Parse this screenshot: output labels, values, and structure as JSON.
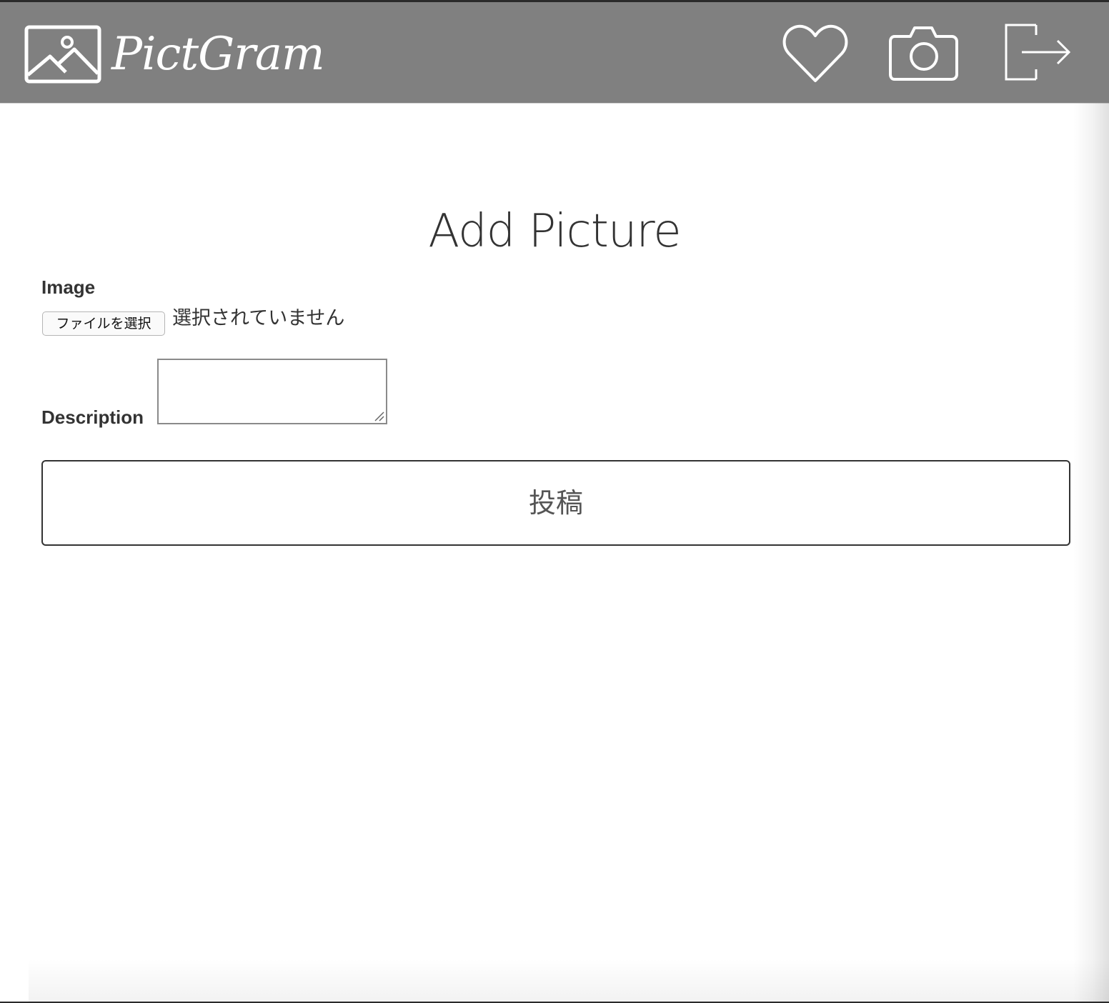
{
  "header": {
    "brand": "PictGram",
    "logo_icon": "picture-landscape-icon",
    "nav": {
      "likes_icon": "heart-icon",
      "post_icon": "camera-icon",
      "logout_icon": "logout-arrow-icon"
    },
    "background_color": "#808080",
    "foreground_color": "#ffffff"
  },
  "main": {
    "title": "Add Picture",
    "image_field": {
      "label": "Image",
      "button_label": "ファイルを選択",
      "status": "選択されていません"
    },
    "description_field": {
      "label": "Description",
      "value": ""
    },
    "submit_label": "投稿"
  }
}
